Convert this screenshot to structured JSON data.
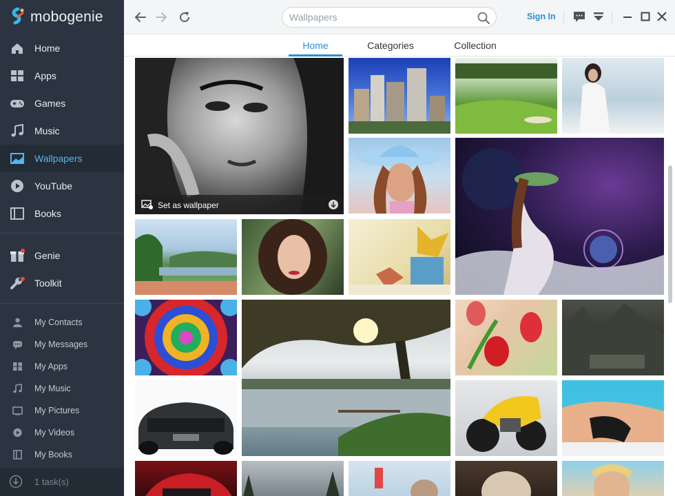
{
  "app": {
    "name": "mobogenie"
  },
  "sidebar": {
    "main": [
      {
        "label": "Home",
        "icon": "home-icon"
      },
      {
        "label": "Apps",
        "icon": "apps-icon"
      },
      {
        "label": "Games",
        "icon": "gamepad-icon"
      },
      {
        "label": "Music",
        "icon": "music-note-icon"
      },
      {
        "label": "Wallpapers",
        "icon": "wallpaper-icon",
        "active": true
      },
      {
        "label": "YouTube",
        "icon": "play-icon"
      },
      {
        "label": "Books",
        "icon": "book-icon"
      }
    ],
    "tools": [
      {
        "label": "Genie",
        "icon": "gift-box-icon"
      },
      {
        "label": "Toolkit",
        "icon": "wrench-icon"
      }
    ],
    "mine": [
      {
        "label": "My Contacts",
        "icon": "contact-icon"
      },
      {
        "label": "My Messages",
        "icon": "message-icon"
      },
      {
        "label": "My Apps",
        "icon": "apps-icon"
      },
      {
        "label": "My Music",
        "icon": "music-note-icon"
      },
      {
        "label": "My Pictures",
        "icon": "picture-icon"
      },
      {
        "label": "My Videos",
        "icon": "video-icon"
      },
      {
        "label": "My Books",
        "icon": "book-icon"
      }
    ],
    "tasks": "1 task(s)"
  },
  "topbar": {
    "search_placeholder": "Wallpapers",
    "sign_in": "Sign In"
  },
  "tabs": [
    {
      "label": "Home",
      "active": true
    },
    {
      "label": "Categories"
    },
    {
      "label": "Collection"
    }
  ],
  "grid": {
    "set_as_wallpaper": "Set as wallpaper",
    "tiles": [
      "portrait-woman-bw",
      "city-skyscrapers",
      "golf-course",
      "woman-white-dress",
      "cowgirl-hat",
      "fantasy-woman-moon",
      "lake-park",
      "woman-curly-hair",
      "autumn-leaves-cup",
      "kaleidoscope",
      "lake-tree-sunset",
      "red-tulips",
      "mountain-village",
      "sports-car",
      "yellow-motorcycle",
      "swimsuit-beach",
      "red-car",
      "forest-clouds",
      "kitten",
      "cat-fluffy",
      "beach-woman"
    ]
  },
  "colors": {
    "sidebar_bg": "#2b3440",
    "accent": "#2a8fd1",
    "active_label": "#4fb8f0"
  }
}
